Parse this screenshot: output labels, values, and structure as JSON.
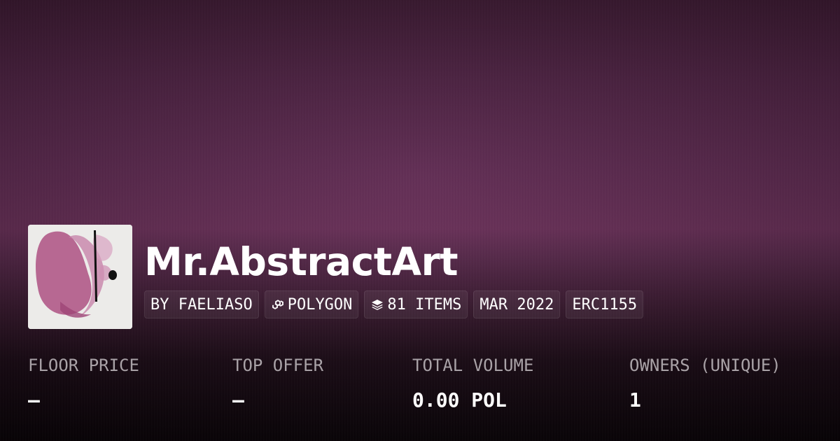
{
  "collection": {
    "title": "Mr.AbstractArt",
    "logo_icon": "abstract-art-logo",
    "tags": [
      {
        "label": "BY FAELIASO",
        "icon": null
      },
      {
        "label": "POLYGON",
        "icon": "polygon-chain-icon"
      },
      {
        "label": "81 ITEMS",
        "icon": "layers-icon"
      },
      {
        "label": "MAR 2022",
        "icon": null
      },
      {
        "label": "ERC1155",
        "icon": null
      }
    ]
  },
  "stats": [
    {
      "label": "FLOOR PRICE",
      "value": "–"
    },
    {
      "label": "TOP OFFER",
      "value": "–"
    },
    {
      "label": "TOTAL VOLUME",
      "value": "0.00 POL"
    },
    {
      "label": "OWNERS (UNIQUE)",
      "value": "1"
    }
  ],
  "colors": {
    "banner_top": "#3d1a33",
    "banner_mid": "#6a3059",
    "banner_bottom": "#0a0408",
    "text_primary": "#ffffff",
    "text_muted": "#a9a2a7"
  }
}
